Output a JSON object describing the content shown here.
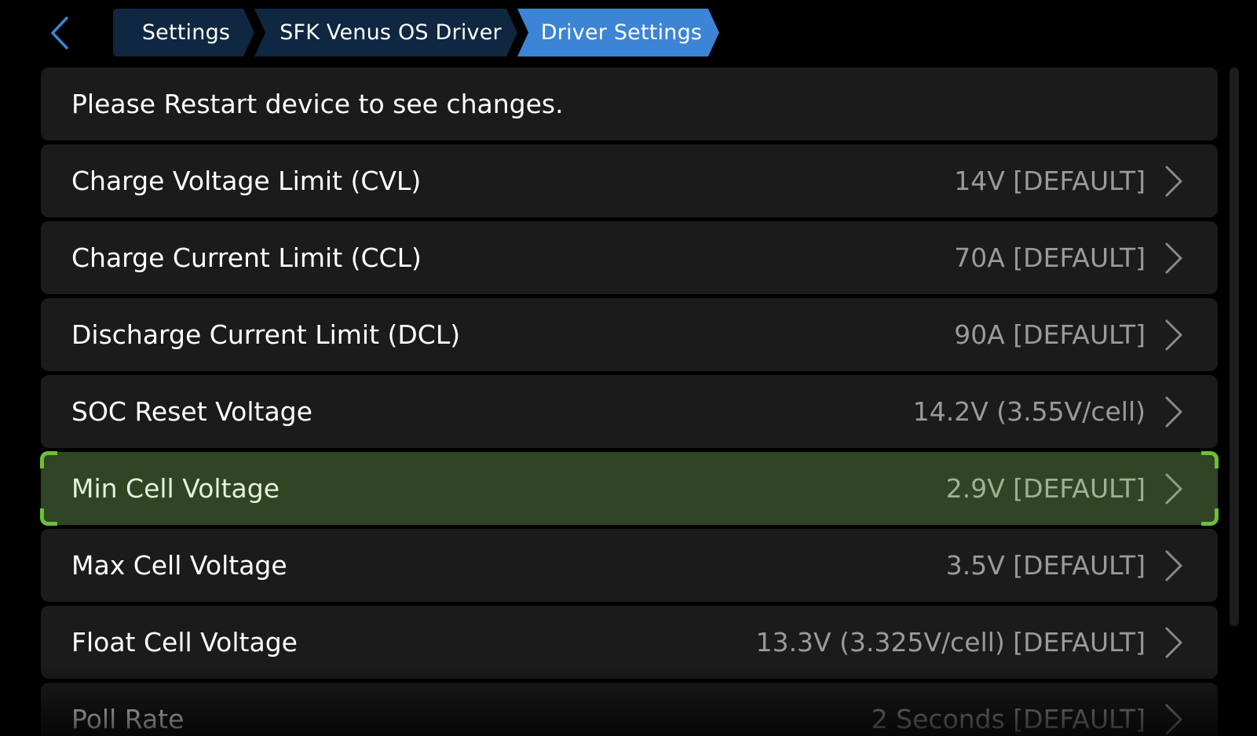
{
  "breadcrumb": {
    "items": [
      {
        "label": "Settings"
      },
      {
        "label": "SFK Venus OS Driver"
      },
      {
        "label": "Driver Settings"
      }
    ]
  },
  "notice": "Please Restart device to see changes.",
  "settings": [
    {
      "label": "Charge Voltage Limit (CVL)",
      "value": "14V [DEFAULT]"
    },
    {
      "label": "Charge Current Limit (CCL)",
      "value": "70A [DEFAULT]"
    },
    {
      "label": "Discharge Current Limit (DCL)",
      "value": "90A [DEFAULT]"
    },
    {
      "label": "SOC Reset Voltage",
      "value": "14.2V (3.55V/cell)"
    },
    {
      "label": "Min Cell Voltage",
      "value": "2.9V [DEFAULT]"
    },
    {
      "label": "Max Cell Voltage",
      "value": "3.5V [DEFAULT]"
    },
    {
      "label": "Float Cell Voltage",
      "value": "13.3V (3.325V/cell) [DEFAULT]"
    },
    {
      "label": "Poll Rate",
      "value": "2 Seconds [DEFAULT]"
    }
  ],
  "selected_index": 4,
  "colors": {
    "accent": "#3b84d6",
    "crumb_bg": "#0f2740",
    "selection_bg": "#2f4524",
    "selection_border": "#6bbf3a",
    "row_bg": "#1b1b1b"
  },
  "icons": {
    "back": "chevron-left-icon",
    "row": "chevron-right-icon"
  }
}
